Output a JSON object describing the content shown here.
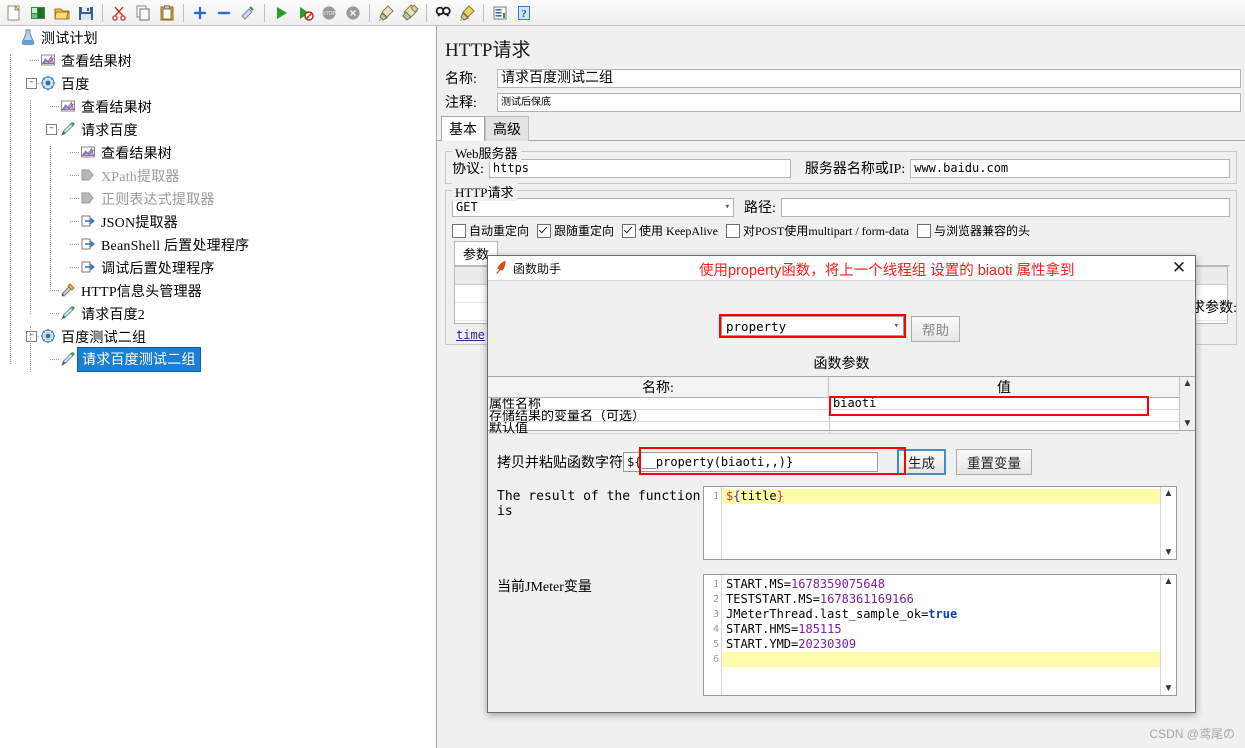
{
  "toolbar": {
    "buttons": [
      {
        "name": "new-icon",
        "glyph": "new"
      },
      {
        "name": "templates-icon",
        "glyph": "templates"
      },
      {
        "name": "open-icon",
        "glyph": "open"
      },
      {
        "name": "save-icon",
        "glyph": "save"
      },
      {
        "sep": true
      },
      {
        "name": "cut-icon",
        "glyph": "cut"
      },
      {
        "name": "copy-icon",
        "glyph": "copy"
      },
      {
        "name": "paste-icon",
        "glyph": "paste"
      },
      {
        "sep": true
      },
      {
        "name": "expand-all-icon",
        "glyph": "plus"
      },
      {
        "name": "collapse-all-icon",
        "glyph": "minus"
      },
      {
        "name": "toggle-icon",
        "glyph": "toggle"
      },
      {
        "sep": true
      },
      {
        "name": "start-icon",
        "glyph": "start"
      },
      {
        "name": "start-no-pauses-icon",
        "glyph": "start-no-pause"
      },
      {
        "name": "stop-icon",
        "glyph": "stop"
      },
      {
        "name": "shutdown-icon",
        "glyph": "shutdown"
      },
      {
        "sep": true
      },
      {
        "name": "clear-icon",
        "glyph": "clear"
      },
      {
        "name": "clear-all-icon",
        "glyph": "clear-all"
      },
      {
        "sep": true
      },
      {
        "name": "search-icon",
        "glyph": "search"
      },
      {
        "name": "reset-search-icon",
        "glyph": "reset-search"
      },
      {
        "sep": true
      },
      {
        "name": "function-helper-icon",
        "glyph": "fnhelper"
      },
      {
        "name": "help-icon",
        "glyph": "help"
      }
    ]
  },
  "tree": {
    "nodes": [
      {
        "label": "测试计划",
        "depth": 0,
        "icon": "test-plan",
        "handle": "",
        "state": "normal"
      },
      {
        "label": "查看结果树",
        "depth": 1,
        "icon": "view-results-tree",
        "handle": "",
        "state": "normal"
      },
      {
        "label": "百度",
        "depth": 1,
        "icon": "thread-group",
        "handle": "minus",
        "state": "normal"
      },
      {
        "label": "查看结果树",
        "depth": 2,
        "icon": "view-results-tree",
        "handle": "",
        "state": "normal"
      },
      {
        "label": "请求百度",
        "depth": 2,
        "icon": "http-sampler",
        "handle": "minus",
        "state": "normal"
      },
      {
        "label": "查看结果树",
        "depth": 3,
        "icon": "view-results-tree",
        "handle": "",
        "state": "normal"
      },
      {
        "label": "XPath提取器",
        "depth": 3,
        "icon": "post-processor-disabled",
        "handle": "",
        "state": "disabled"
      },
      {
        "label": "正则表达式提取器",
        "depth": 3,
        "icon": "post-processor-disabled",
        "handle": "",
        "state": "disabled"
      },
      {
        "label": "JSON提取器",
        "depth": 3,
        "icon": "post-processor",
        "handle": "",
        "state": "normal"
      },
      {
        "label": "BeanShell 后置处理程序",
        "depth": 3,
        "icon": "post-processor",
        "handle": "",
        "state": "normal"
      },
      {
        "label": "调试后置处理程序",
        "depth": 3,
        "icon": "post-processor",
        "handle": "",
        "state": "normal"
      },
      {
        "label": "HTTP信息头管理器",
        "depth": 2,
        "icon": "header-manager",
        "handle": "",
        "state": "normal"
      },
      {
        "label": "请求百度2",
        "depth": 2,
        "icon": "http-sampler",
        "handle": "",
        "state": "normal"
      },
      {
        "label": "百度测试二组",
        "depth": 1,
        "icon": "thread-group",
        "handle": "minus",
        "state": "normal"
      },
      {
        "label": "请求百度测试二组",
        "depth": 2,
        "icon": "http-sampler",
        "handle": "",
        "state": "selected"
      }
    ]
  },
  "content": {
    "title": "HTTP请求",
    "name_label": "名称:",
    "name_value": "请求百度测试二组",
    "comment_label": "注释:",
    "comment_value": "测试后保底",
    "tabs": [
      {
        "label": "基本",
        "active": true
      },
      {
        "label": "高级",
        "active": false
      }
    ],
    "webserver": {
      "group_title": "Web服务器",
      "protocol_label": "协议:",
      "protocol_value": "https",
      "host_label": "服务器名称或IP:",
      "host_value": "www.baidu.com"
    },
    "httprequest": {
      "group_title": "HTTP请求",
      "method_value": "GET",
      "path_label": "路径:",
      "path_value": "",
      "checkboxes": [
        {
          "label": "自动重定向",
          "checked": false
        },
        {
          "label": "跟随重定向",
          "checked": true
        },
        {
          "label": "使用 KeepAlive",
          "checked": true
        },
        {
          "label": "对POST使用multipart / form-data",
          "checked": false
        },
        {
          "label": "与浏览器兼容的头",
          "checked": false
        }
      ]
    },
    "params_tab": "参数",
    "right_param_label": "请求参数:",
    "time_link": "time"
  },
  "dialog": {
    "title": "函数助手",
    "annotation": "使用property函数，将上一个线程组 设置的 biaoti 属性拿到",
    "close_label": "✕",
    "function_select": "property",
    "help_button": "帮助",
    "params_title": "函数参数",
    "table": {
      "headers": [
        "名称:",
        "值"
      ],
      "rows": [
        {
          "name": "属性名称",
          "value": "biaoti",
          "highlight": true
        },
        {
          "name": "存储结果的变量名（可选）",
          "value": "",
          "highlight": false
        },
        {
          "name": "默认值",
          "value": "",
          "highlight": false
        }
      ]
    },
    "copy_label": "拷贝并粘贴函数字符串",
    "copy_value": "${__property(biaoti,,)}",
    "generate_button": "生成",
    "reset_button": "重置变量",
    "result_label": "The result of the function is",
    "result_lines": [
      {
        "num": "1",
        "text": "${title}",
        "highlight": true
      }
    ],
    "vars_label": "当前JMeter变量",
    "vars_lines": [
      {
        "num": "1",
        "key": "START.MS=",
        "val": "1678359075648",
        "type": "num",
        "highlight": false
      },
      {
        "num": "2",
        "key": "TESTSTART.MS=",
        "val": "1678361169166",
        "type": "num",
        "highlight": false
      },
      {
        "num": "3",
        "key": "JMeterThread.last_sample_ok=",
        "val": "true",
        "type": "kw",
        "highlight": false
      },
      {
        "num": "4",
        "key": "START.HMS=",
        "val": "185115",
        "type": "num",
        "highlight": false
      },
      {
        "num": "5",
        "key": "START.YMD=",
        "val": "20230309",
        "type": "num",
        "highlight": false
      },
      {
        "num": "6",
        "key": "",
        "val": "",
        "type": "num",
        "highlight": true
      }
    ]
  },
  "watermark": "CSDN @鸢尾の",
  "colors": {
    "accent_red": "#ff1a1a",
    "selection_blue": "#1b7fd4",
    "number_purple": "#7a1fa2",
    "keyword_blue": "#1040c0",
    "highlight_yellow": "#fffcaa"
  }
}
